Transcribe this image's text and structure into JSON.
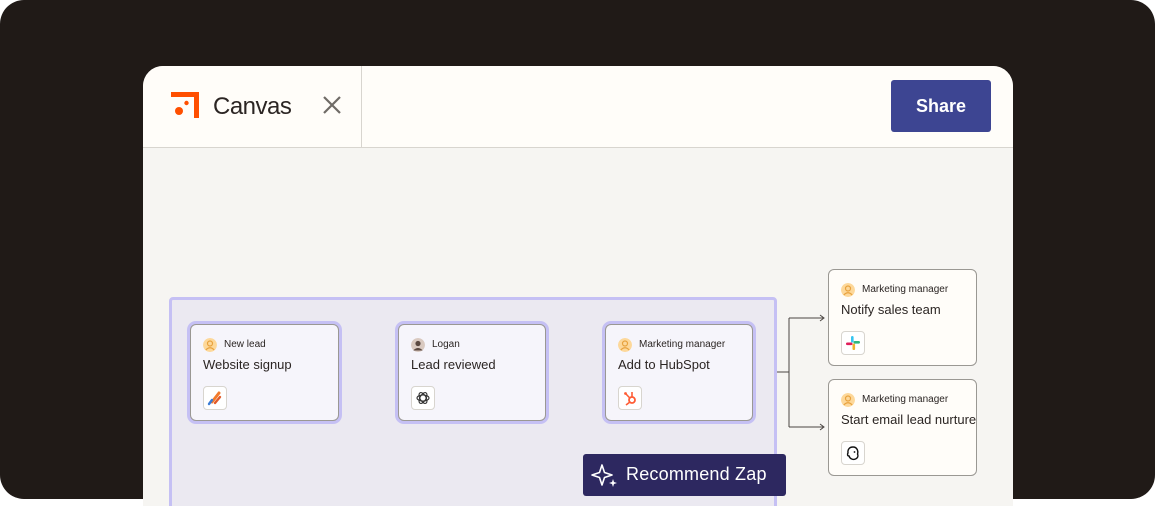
{
  "app": {
    "title": "Canvas",
    "brand_color": "#ff4f00",
    "share_label": "Share",
    "icons": {
      "logo": "zapier-canvas-logo",
      "close": "close-icon"
    }
  },
  "colors": {
    "frame": "#201a17",
    "canvas": "#f6f5f2",
    "share_button": "#3d4592",
    "group_border": "#c5c0f4",
    "recommend_button": "#2d2860"
  },
  "group": {
    "recommend_label": "Recommend Zap",
    "recommend_icon": "sparkle-icon",
    "steps": [
      {
        "actor": "New lead",
        "title": "Website signup",
        "app_icon": "form-app-icon"
      },
      {
        "actor": "Logan",
        "title": "Lead reviewed",
        "app_icon": "openai-icon"
      },
      {
        "actor": "Marketing manager",
        "title": "Add to HubSpot",
        "app_icon": "hubspot-icon"
      }
    ]
  },
  "branches": [
    {
      "actor": "Marketing manager",
      "title": "Notify sales team",
      "app_icon": "slack-icon"
    },
    {
      "actor": "Marketing manager",
      "title": "Start email lead nurture",
      "app_icon": "mailchimp-icon"
    }
  ]
}
